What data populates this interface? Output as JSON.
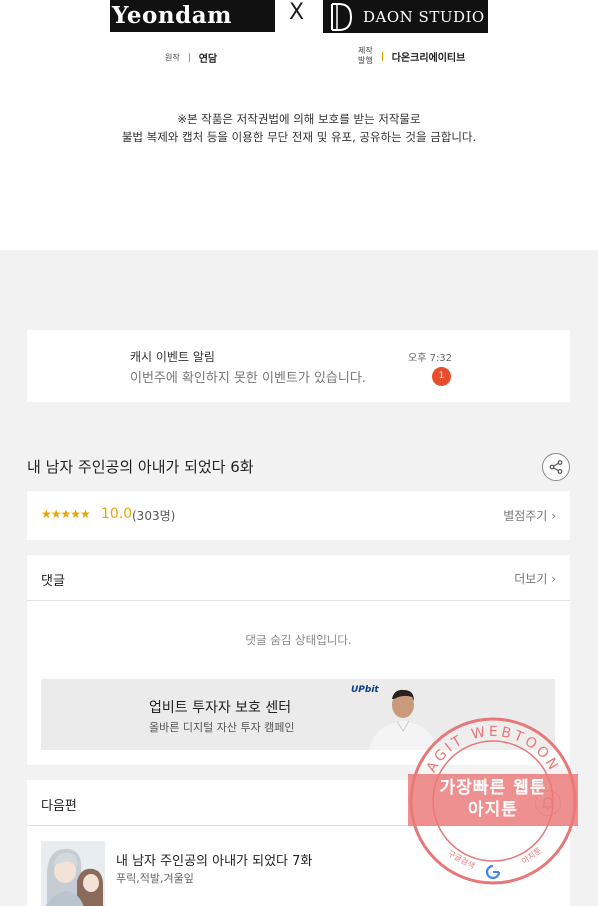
{
  "header": {
    "logo_left": "Yeondam",
    "separator": "X",
    "logo_right": "DAON STUDIO",
    "credit_original_label": "원작",
    "credit_original_value": "연담",
    "credit_production_label_1": "제작",
    "credit_production_label_2": "발행",
    "credit_production_value": "다온크리에이티브",
    "notice_line_1": "※본 작품은 저작권법에 의해 보호를 받는 저작물로",
    "notice_line_2": "불법 복제와 캡처 등을 이용한 무단 전재 및 유포, 공유하는 것을 금합니다."
  },
  "event": {
    "title": "캐시 이벤트 알림",
    "message": "이번주에 확인하지 못한 이벤트가 있습니다.",
    "time": "오후 7:32",
    "badge": "1"
  },
  "episode": {
    "title": "내 남자 주인공의 아내가 되었다 6화",
    "share_icon": "share-icon"
  },
  "rating": {
    "stars": "★★★★★",
    "score": "10.0",
    "count": "(303명)",
    "rate_link": "별점주기",
    "star_color": "#e6a800"
  },
  "comments": {
    "title": "댓글",
    "more": "더보기",
    "hidden_message": "댓글 숨김 상태입니다."
  },
  "ad": {
    "title": "업비트 투자자 보호 센터",
    "subtitle": "올바른 디지털 자산 투자 캠페인",
    "brand": "UPbit"
  },
  "next": {
    "title": "다음편",
    "episode_title": "내 남자 주인공의 아내가 되었다 7화",
    "authors": "푸릭,적발,겨울잎"
  },
  "watermark": {
    "ring_text": "AGIT WEBTOON",
    "banner_line_1": "가장빠른 웹툰",
    "banner_line_2": "아지툰",
    "bottom_left": "구글검색",
    "bottom_right": "아지툰",
    "color": "#e87878"
  }
}
